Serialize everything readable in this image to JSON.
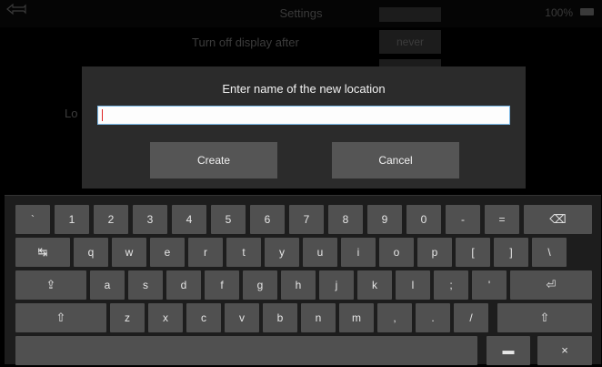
{
  "status_bar": {
    "title": "Settings",
    "battery": "100%",
    "back_icon": "back-arrow-icon",
    "battery_icon": "battery-icon"
  },
  "background": {
    "turn_off_label": "Turn off display after",
    "turn_off_value": "never",
    "location_label": "Lo"
  },
  "dialog": {
    "title": "Enter name of the new location",
    "input_value": "",
    "create_label": "Create",
    "cancel_label": "Cancel"
  },
  "keyboard": {
    "row1": [
      "`",
      "1",
      "2",
      "3",
      "4",
      "5",
      "6",
      "7",
      "8",
      "9",
      "0",
      "-",
      "="
    ],
    "backspace": "⌫",
    "tab": "↹",
    "row2": [
      "q",
      "w",
      "e",
      "r",
      "t",
      "y",
      "u",
      "i",
      "o",
      "p",
      "[",
      "]",
      "\\"
    ],
    "caps": "⇪",
    "row3": [
      "a",
      "s",
      "d",
      "f",
      "g",
      "h",
      "j",
      "k",
      "l",
      ";",
      "'"
    ],
    "enter": "⏎",
    "shift_left": "⇧",
    "row4": [
      "z",
      "x",
      "c",
      "v",
      "b",
      "n",
      "m",
      ",",
      ".",
      "/"
    ],
    "shift_right": "⇧",
    "space": "",
    "hide": "▬",
    "close": "×"
  },
  "colors": {
    "dialog_bg": "#2b2b2b",
    "button_bg": "#555555",
    "key_bg": "#505050",
    "keyboard_bg": "#1d1d1d",
    "input_border": "#7ab8e6"
  }
}
